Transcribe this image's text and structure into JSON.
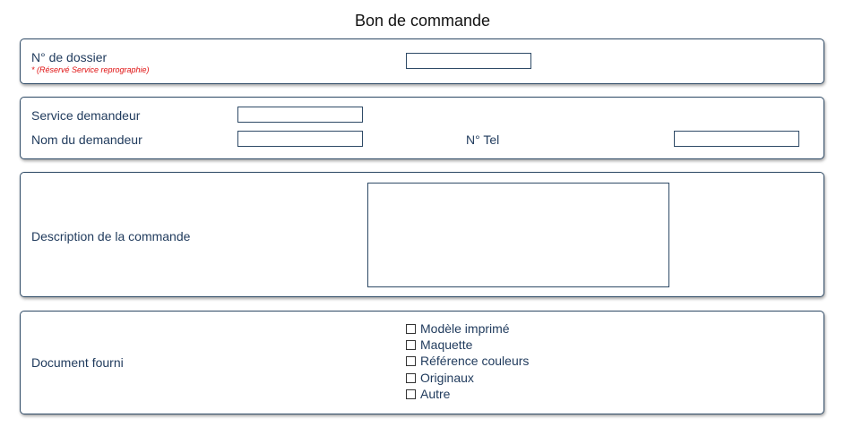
{
  "header": {
    "title": "Bon de commande"
  },
  "dossier": {
    "label": "N° de dossier",
    "note": "* (Réservé Service reprographie)",
    "value": ""
  },
  "demandeur": {
    "service_label": "Service demandeur",
    "service_value": "",
    "nom_label": "Nom du demandeur",
    "nom_value": "",
    "tel_label": "N° Tel",
    "tel_value": ""
  },
  "description": {
    "label": "Description de la commande",
    "value": ""
  },
  "documents": {
    "label": "Document fourni",
    "options": [
      {
        "label": "Modèle imprimé",
        "checked": false
      },
      {
        "label": "Maquette",
        "checked": false
      },
      {
        "label": "Référence couleurs",
        "checked": false
      },
      {
        "label": "Originaux",
        "checked": false
      },
      {
        "label": "Autre",
        "checked": false
      }
    ]
  }
}
